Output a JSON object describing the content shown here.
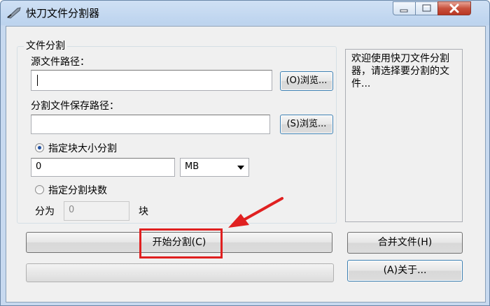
{
  "window": {
    "title": "快刀文件分割器"
  },
  "group": {
    "title": "文件分割",
    "source_label": "源文件路径：",
    "source_value": "",
    "source_browse": "(O)浏览...",
    "save_label": "分割文件保存路径：",
    "save_value": "",
    "save_browse": "(S)浏览..."
  },
  "split_by_size": {
    "label": "指定块大小分割",
    "selected": true,
    "size_value": "0",
    "unit_selected": "MB"
  },
  "split_by_count": {
    "label": "指定分割块数",
    "selected": false,
    "prefix": "分为",
    "count_value": "0",
    "suffix": "块"
  },
  "info": {
    "text": "欢迎使用快刀文件分割器，请选择要分割的文件..."
  },
  "actions": {
    "start": "开始分割(C)",
    "merge": "合并文件(H)",
    "about": "(A)关于..."
  },
  "progress": {
    "value": 0
  },
  "colors": {
    "highlight": "#e02020",
    "radio_dot": "#1f4fa1"
  }
}
